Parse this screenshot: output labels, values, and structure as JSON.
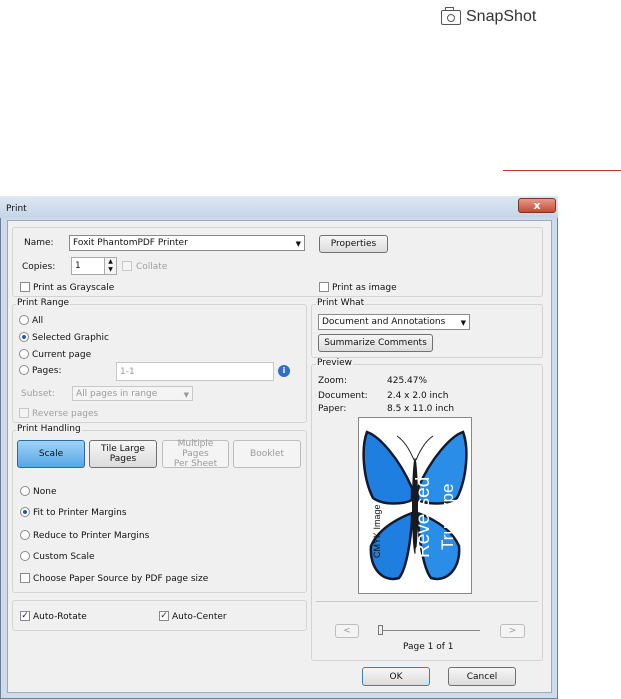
{
  "header": {
    "snapshot_label": "SnapShot",
    "snapshot_icon": "camera-icon"
  },
  "dialog": {
    "title": "Print",
    "close_label": "x",
    "printer": {
      "name_label": "Name:",
      "name_value": "Foxit PhantomPDF Printer",
      "properties_label": "Properties",
      "copies_label": "Copies:",
      "copies_value": "1",
      "collate_label": "Collate",
      "grayscale_label": "Print as Grayscale",
      "print_as_image_label": "Print as image"
    },
    "print_range": {
      "title": "Print Range",
      "all_label": "All",
      "selected_graphic_label": "Selected Graphic",
      "current_page_label": "Current page",
      "pages_label": "Pages:",
      "pages_value": "1-1",
      "subset_label": "Subset:",
      "subset_value": "All pages in range",
      "reverse_label": "Reverse pages",
      "selected": "Selected Graphic"
    },
    "print_handling": {
      "title": "Print Handling",
      "tabs": [
        "Scale",
        "Tile Large Pages",
        "Multiple Pages Per Sheet",
        "Booklet"
      ],
      "tile_line1": "Tile Large",
      "tile_line2": "Pages",
      "multi_line1": "Multiple Pages",
      "multi_line2": "Per Sheet",
      "none_label": "None",
      "fit_label": "Fit to Printer Margins",
      "reduce_label": "Reduce to Printer Margins",
      "custom_label": "Custom Scale",
      "paper_source_label": "Choose Paper Source by PDF page size",
      "selected": "Fit to Printer Margins"
    },
    "auto": {
      "rotate_label": "Auto-Rotate",
      "center_label": "Auto-Center",
      "rotate_checked": true,
      "center_checked": true
    },
    "print_what": {
      "title": "Print What",
      "value": "Document and Annotations",
      "summarize_label": "Summarize Comments"
    },
    "preview": {
      "title": "Preview",
      "zoom_label": "Zoom:",
      "zoom_value": "425.47%",
      "document_label": "Document:",
      "document_value": "2.4 x 2.0 inch",
      "paper_label": "Paper:",
      "paper_value": "8.5 x 11.0 inch",
      "image_text_cmyk": "CMYK Image",
      "image_text_reversed": "Reversed",
      "image_text_truetype": "Truetype",
      "prev_label": "<",
      "next_label": ">",
      "page_indicator": "Page 1 of 1",
      "slider_position": 0
    },
    "ok_label": "OK",
    "cancel_label": "Cancel"
  },
  "colors": {
    "butterfly_blue": "#1f7fe0",
    "butterfly_dark": "#111a2e",
    "selected_tab": "#56a7e4"
  }
}
